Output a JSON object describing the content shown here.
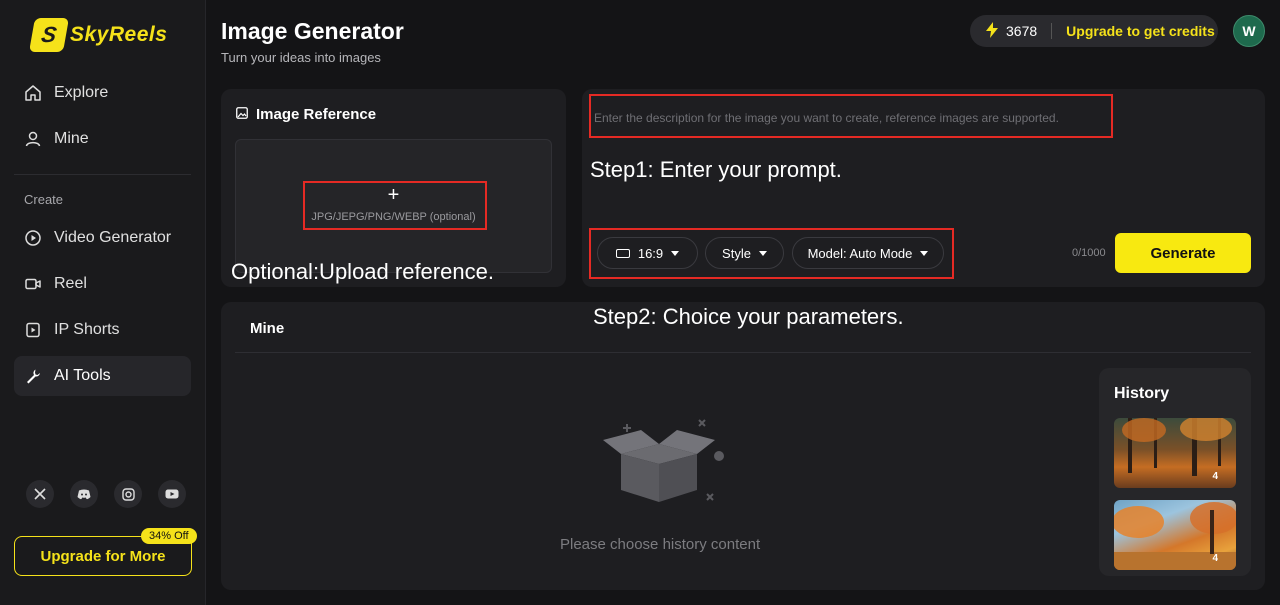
{
  "brand": {
    "logo_text": "SkyReels",
    "accent_color": "#f5e21a"
  },
  "sidebar": {
    "top_items": [
      {
        "label": "Explore",
        "icon": "home-icon"
      },
      {
        "label": "Mine",
        "icon": "user-icon"
      }
    ],
    "section_label": "Create",
    "create_items": [
      {
        "label": "Video Generator",
        "icon": "play-circle-icon"
      },
      {
        "label": "Reel",
        "icon": "video-camera-icon"
      },
      {
        "label": "IP Shorts",
        "icon": "shorts-icon"
      },
      {
        "label": "AI Tools",
        "icon": "wrench-icon",
        "active": true
      }
    ],
    "socials": [
      "x-icon",
      "discord-icon",
      "instagram-icon",
      "youtube-icon"
    ],
    "upgrade_label": "Upgrade for More",
    "upgrade_badge": "34% Off"
  },
  "header": {
    "title": "Image Generator",
    "subtitle": "Turn your ideas into images",
    "credits": "3678",
    "upgrade_link": "Upgrade to get credits",
    "avatar_initial": "W"
  },
  "reference": {
    "title": "Image Reference",
    "plus": "+",
    "hint": "JPG/JEPG/PNG/WEBP (optional)"
  },
  "prompt": {
    "placeholder": "Enter the description for the image you want to create, reference images are supported.",
    "ratio_label": "16:9",
    "style_label": "Style",
    "model_label": "Model: Auto Mode",
    "counter": "0/1000",
    "generate_label": "Generate"
  },
  "mine": {
    "title": "Mine",
    "empty_text": "Please choose history content"
  },
  "history": {
    "title": "History",
    "items": [
      {
        "count": "4"
      },
      {
        "count": "4"
      }
    ]
  },
  "annotations": {
    "step1": "Step1: Enter your prompt.",
    "step2": "Step2: Choice your parameters.",
    "optional": "Optional:Upload reference."
  }
}
